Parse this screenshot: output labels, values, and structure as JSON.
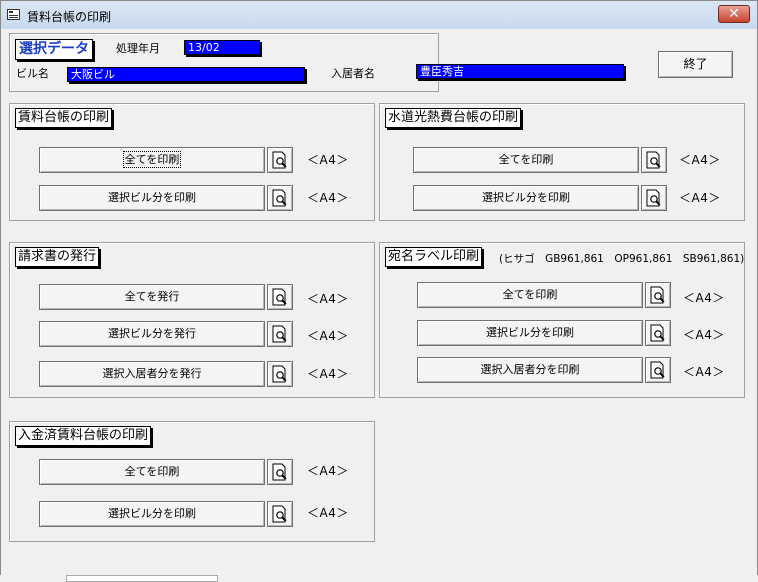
{
  "window": {
    "title": "賃料台帳の印刷",
    "close_glyph": "✕"
  },
  "selection": {
    "title": "選択データ",
    "period_label": "処理年月",
    "period_value": "13/02",
    "building_label": "ビル名",
    "building_value": "大阪ビル",
    "tenant_label": "入居者名",
    "tenant_value": "豊臣秀吉"
  },
  "exit_button": "終了",
  "groups": {
    "rent_ledger": {
      "title": "賃料台帳の印刷",
      "buttons": [
        {
          "label": "全てを印刷",
          "paper": "＜A4＞"
        },
        {
          "label": "選択ビル分を印刷",
          "paper": "＜A4＞"
        }
      ]
    },
    "utility_ledger": {
      "title": "水道光熱費台帳の印刷",
      "buttons": [
        {
          "label": "全てを印刷",
          "paper": "＜A4＞"
        },
        {
          "label": "選択ビル分を印刷",
          "paper": "＜A4＞"
        }
      ]
    },
    "invoice": {
      "title": "請求書の発行",
      "buttons": [
        {
          "label": "全てを発行",
          "paper": "＜A4＞"
        },
        {
          "label": "選択ビル分を発行",
          "paper": "＜A4＞"
        },
        {
          "label": "選択入居者分を発行",
          "paper": "＜A4＞"
        }
      ]
    },
    "address_label": {
      "title": "宛名ラベル印刷",
      "note": "(ヒサゴ　GB961,861　OP961,861　SB961,861)",
      "buttons": [
        {
          "label": "全てを印刷",
          "paper": "＜A4＞"
        },
        {
          "label": "選択ビル分を印刷",
          "paper": "＜A4＞"
        },
        {
          "label": "選択入居者分を印刷",
          "paper": "＜A4＞"
        }
      ]
    },
    "paid_ledger": {
      "title": "入金済賃料台帳の印刷",
      "buttons": [
        {
          "label": "全てを印刷",
          "paper": "＜A4＞"
        },
        {
          "label": "選択ビル分を印刷",
          "paper": "＜A4＞"
        }
      ]
    }
  },
  "icons": {
    "preview": "print-preview-magnifier-icon",
    "window": "form-icon",
    "close": "close-icon"
  },
  "colors": {
    "highlight": "#0000ff",
    "caption_text": "#1a3ec8",
    "close": "#c7432f"
  }
}
